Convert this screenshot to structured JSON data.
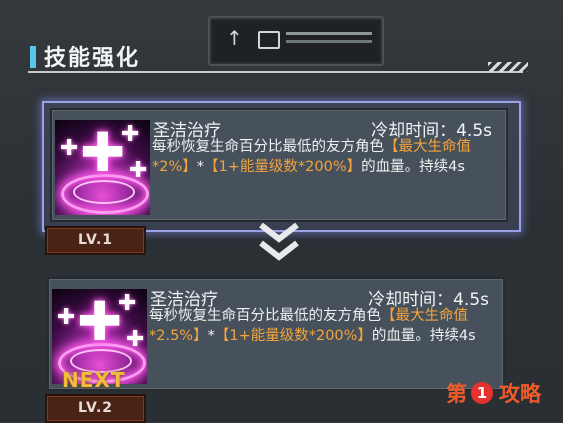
{
  "header": {
    "title": "技能强化"
  },
  "skills": [
    {
      "name": "圣洁治疗",
      "cooldown": "冷却时间：4.5s",
      "desc_a": "每秒恢复生命百分比最低的友方角色",
      "desc_hl1": "【最大生命值*2%】",
      "desc_b": "*",
      "desc_hl2": "【1+能量级数*200%】",
      "desc_c": "的血量。持续4s",
      "level": "LV.1"
    },
    {
      "name": "圣洁治疗",
      "cooldown": "冷却时间：4.5s",
      "desc_a": "每秒恢复生命百分比最低的友方角色",
      "desc_hl1": "【最大生命值*2.5%】",
      "desc_b": "*",
      "desc_hl2": "【1+能量级数*200%】",
      "desc_c": "的血量。持续4s",
      "level": "LV.2",
      "next_label": "NEXT"
    }
  ],
  "watermark": {
    "pre": "第",
    "num": "1",
    "post": "攻略"
  },
  "colors": {
    "highlight": "#f3a43e",
    "accent": "#58c8ea",
    "selection": "#9aa2e6"
  }
}
